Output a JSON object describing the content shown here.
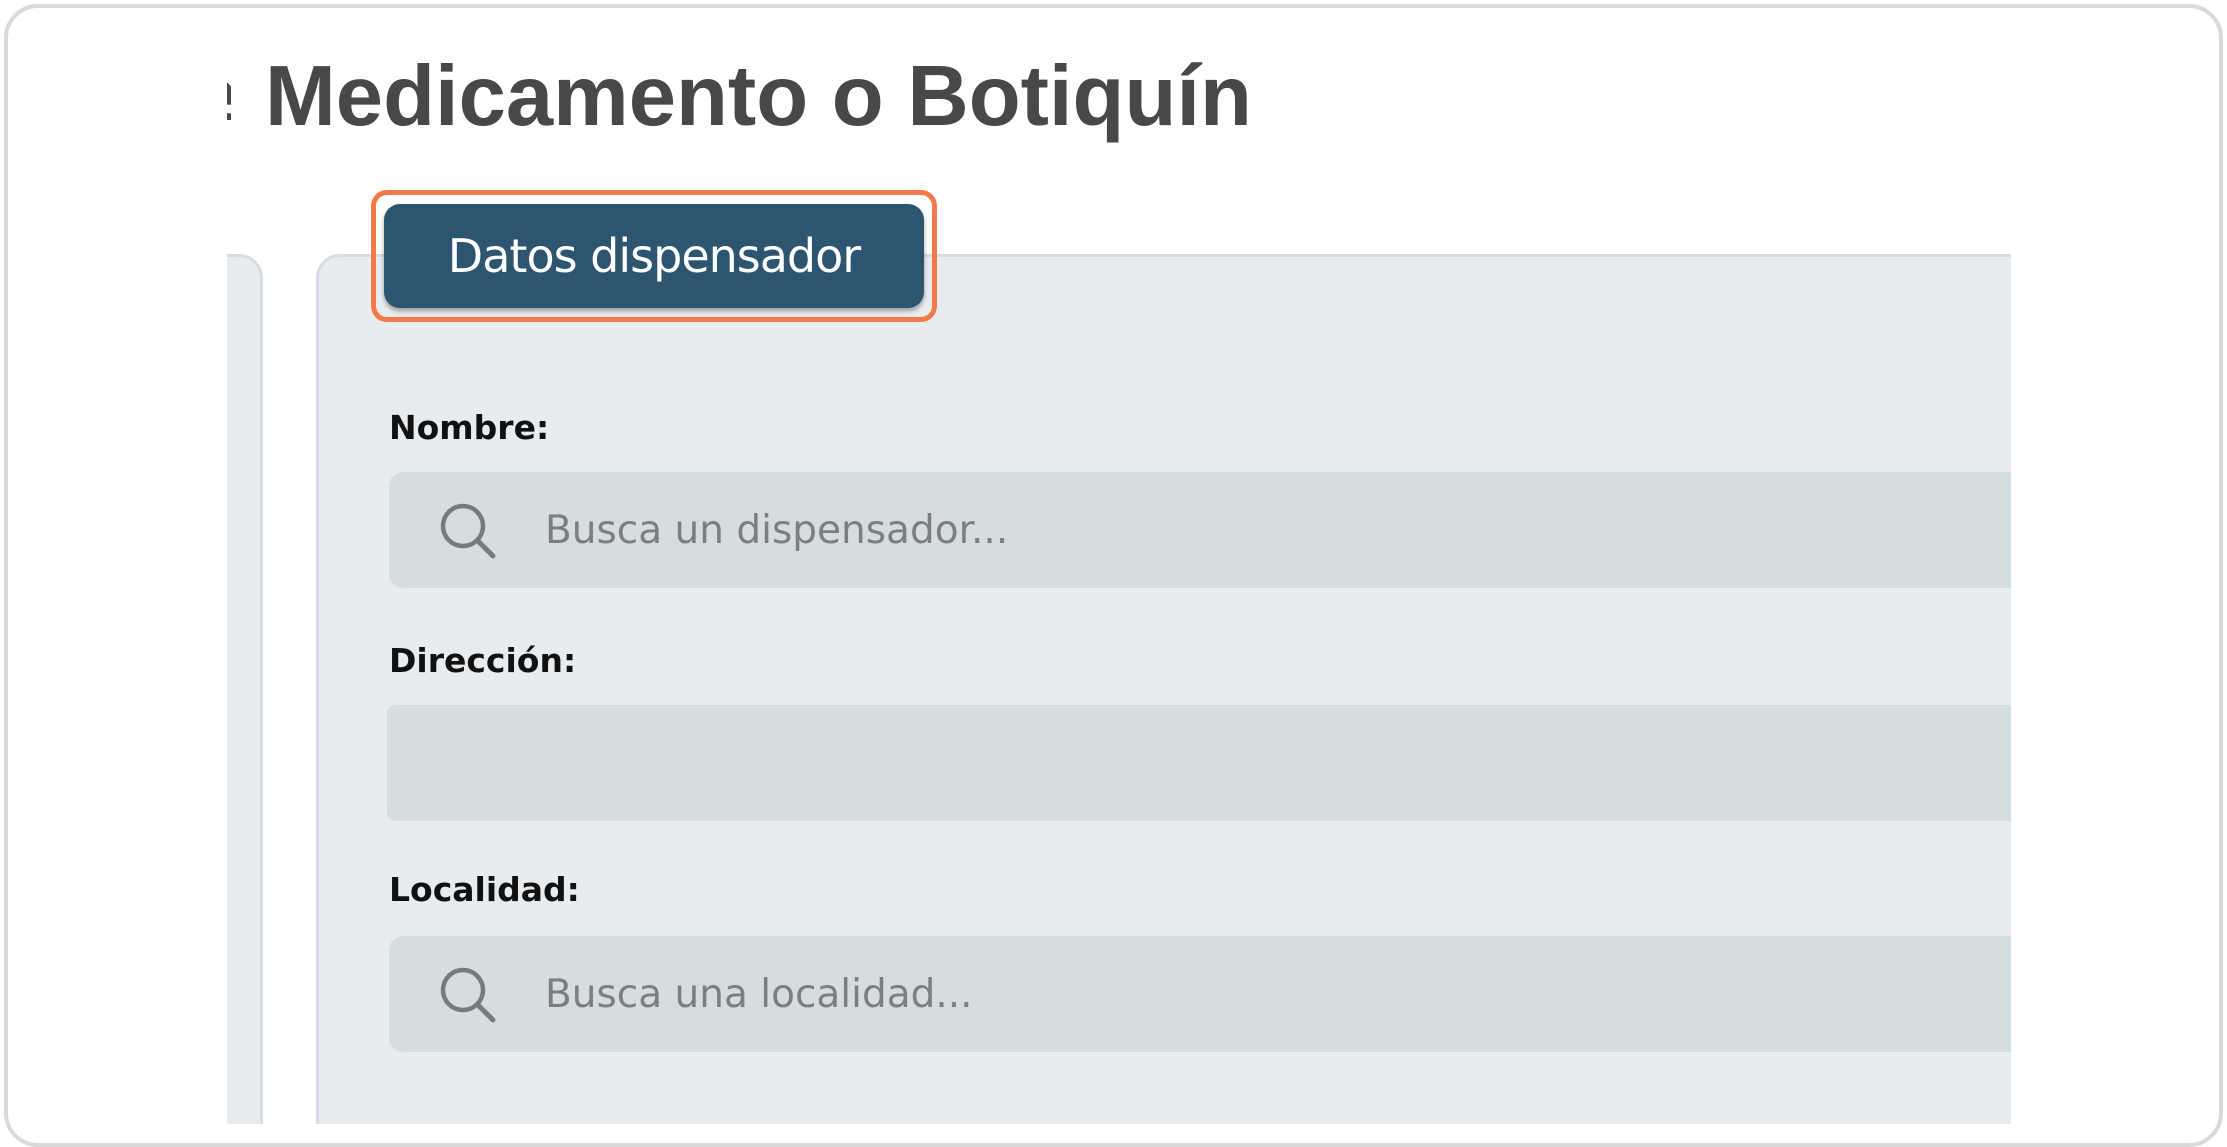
{
  "page": {
    "title": "Medicamento o Botiquín",
    "title_cut_prefix": "e"
  },
  "tab": {
    "label": "Datos dispensador",
    "active": true,
    "highlight_color": "#f27a4a",
    "color": "#2e5570"
  },
  "form": {
    "fields": [
      {
        "label": "Nombre:",
        "placeholder": "Busca un dispensador...",
        "value": "",
        "icon": "search-icon"
      },
      {
        "label": "Dirección:",
        "placeholder": "",
        "value": ""
      },
      {
        "label": "Localidad:",
        "placeholder": "Busca una localidad...",
        "value": "",
        "icon": "search-icon"
      }
    ]
  }
}
